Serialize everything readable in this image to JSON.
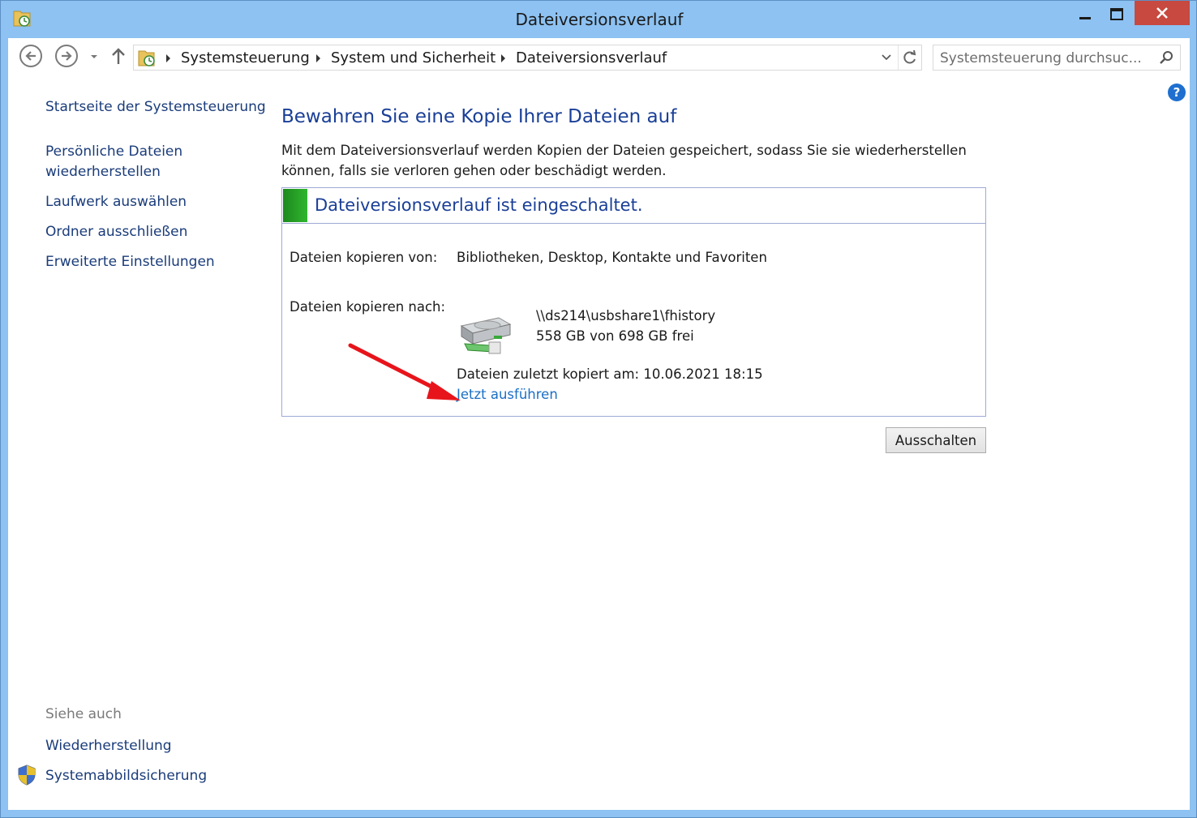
{
  "window": {
    "title": "Dateiversionsverlauf"
  },
  "navigation": {
    "breadcrumb": [
      "Systemsteuerung",
      "System und Sicherheit",
      "Dateiversionsverlauf"
    ],
    "search_placeholder": "Systemsteuerung durchsuc..."
  },
  "sidebar": {
    "home": "Startseite der Systemsteuerung",
    "items": [
      "Persönliche Dateien wiederherstellen",
      "Laufwerk auswählen",
      "Ordner ausschließen",
      "Erweiterte Einstellungen"
    ],
    "see_also_label": "Siehe auch",
    "see_also": [
      "Wiederherstellung",
      "Systemabbildsicherung"
    ]
  },
  "main": {
    "heading": "Bewahren Sie eine Kopie Ihrer Dateien auf",
    "intro": "Mit dem Dateiversionsverlauf werden Kopien der Dateien gespeichert, sodass Sie sie wiederherstellen können, falls sie verloren gehen oder beschädigt werden.",
    "status": {
      "title": "Dateiversionsverlauf ist eingeschaltet.",
      "copy_from_label": "Dateien kopieren von:",
      "copy_from_value": "Bibliotheken, Desktop, Kontakte und Favoriten",
      "copy_to_label": "Dateien kopieren nach:",
      "drive_path": "\\\\ds214\\usbshare1\\fhistory",
      "drive_free": "558 GB von 698 GB frei",
      "last_copy": "Dateien zuletzt kopiert am: 10.06.2021 18:15",
      "run_now": "Jetzt ausführen"
    },
    "off_button": "Ausschalten"
  },
  "colors": {
    "titlebar": "#8dc2f2",
    "close_button": "#c7493f",
    "heading": "#1a3f97",
    "link": "#1a6fc4",
    "status_green": "#2fb52f",
    "annotation_arrow": "#e8141b"
  }
}
